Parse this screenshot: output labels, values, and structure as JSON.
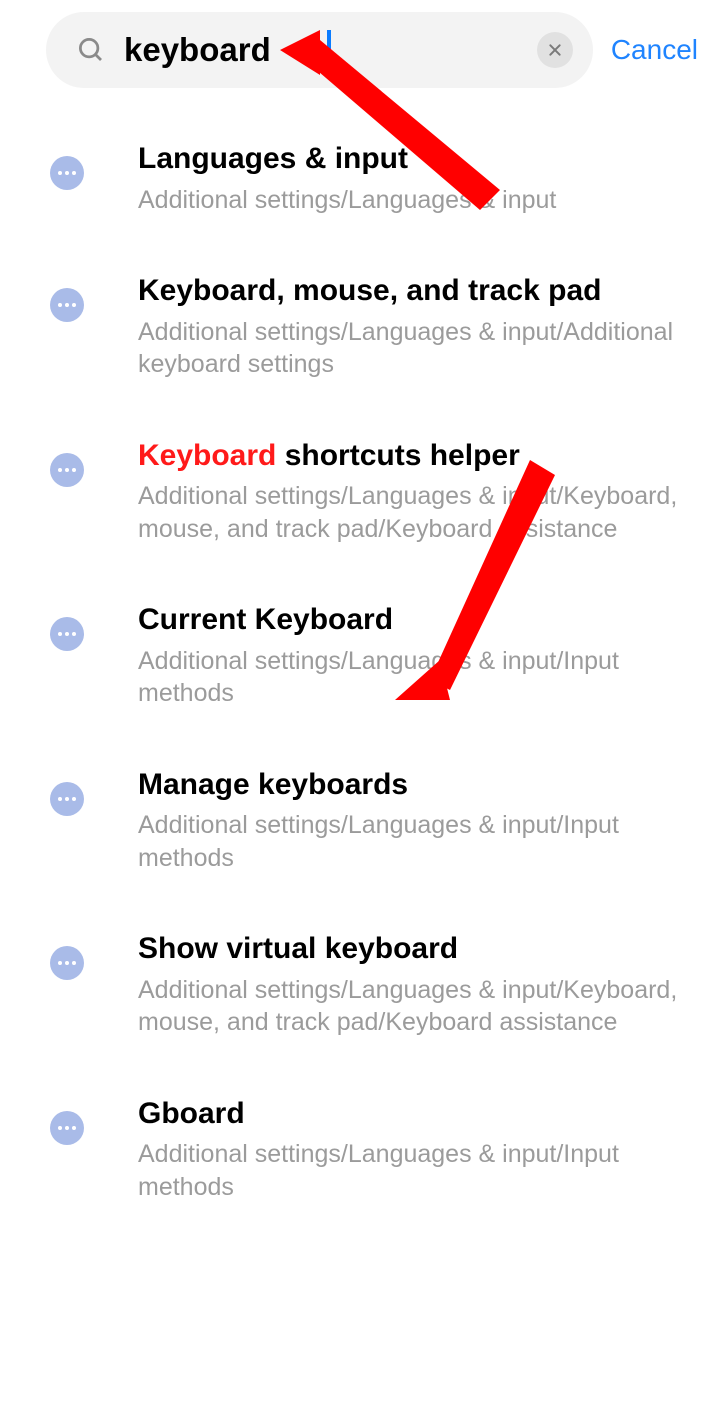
{
  "search": {
    "query": "keyboard",
    "cancel_label": "Cancel"
  },
  "results": [
    {
      "title_pre": "",
      "title_hl": "",
      "title_post": "Languages & input",
      "path": "Additional settings/Languages & input"
    },
    {
      "title_pre": "",
      "title_hl": "",
      "title_post": "Keyboard, mouse, and track pad",
      "path": "Additional settings/Languages & input/Additional keyboard settings"
    },
    {
      "title_pre": "",
      "title_hl": "Keyboard",
      "title_post": " shortcuts helper",
      "path": "Additional settings/Languages & input/Keyboard, mouse, and track pad/Keyboard assistance"
    },
    {
      "title_pre": "",
      "title_hl": "",
      "title_post": "Current Keyboard",
      "path": "Additional settings/Languages & input/Input methods"
    },
    {
      "title_pre": "",
      "title_hl": "",
      "title_post": "Manage keyboards",
      "path": "Additional settings/Languages & input/Input methods"
    },
    {
      "title_pre": "",
      "title_hl": "",
      "title_post": "Show virtual keyboard",
      "path": "Additional settings/Languages & input/Keyboard, mouse, and track pad/Keyboard assistance"
    },
    {
      "title_pre": "",
      "title_hl": "",
      "title_post": "Gboard",
      "path": "Additional settings/Languages & input/Input methods"
    }
  ],
  "annotation": {
    "arrow1_target": "search-input",
    "arrow2_target": "result-manage-keyboards"
  }
}
